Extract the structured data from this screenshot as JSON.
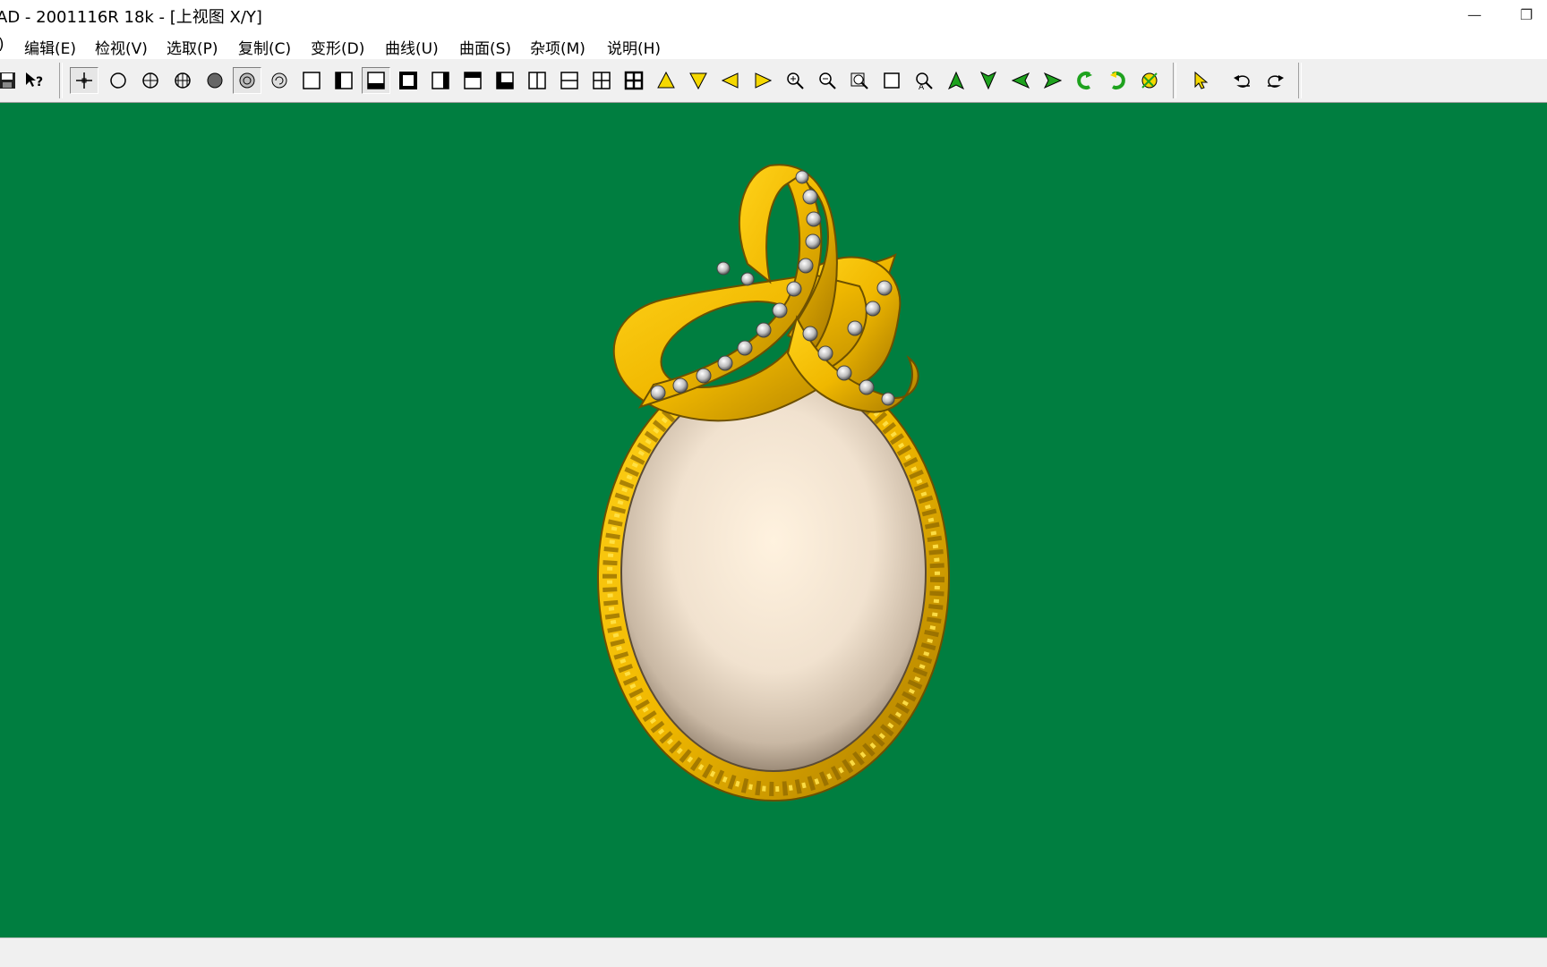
{
  "window": {
    "title": "AD - 2001116R 18k - [上视图 X/Y]",
    "minimize_glyph": "—",
    "restore_glyph": "❐"
  },
  "menu": {
    "partial_item": ")",
    "items": [
      "编辑(E)",
      "检视(V)",
      "选取(P)",
      "复制(C)",
      "变形(D)",
      "曲线(U)",
      "曲面(S)",
      "杂项(M)",
      "说明(H)"
    ]
  },
  "toolbar": {
    "help_glyph": "?",
    "icons": [
      "save-icon",
      "context-help-icon",
      "point-snap-icon",
      "circle-snap-icon",
      "center-snap-icon",
      "grid-snap-icon",
      "solid-dot-icon",
      "shaded-dot-icon",
      "refresh-circle-icon",
      "single-view-icon",
      "left-view-icon",
      "bottom-view-icon",
      "frame-view-icon",
      "right-view-icon",
      "top-view-icon",
      "bottom-panel-icon",
      "split-vertical-icon",
      "split-horizontal-icon",
      "four-view-icon",
      "four-view-bold-icon",
      "move-up-icon",
      "move-down-icon",
      "move-left-icon",
      "move-right-icon",
      "zoom-in-icon",
      "zoom-out-icon",
      "zoom-window-icon",
      "zoom-frame-icon",
      "zoom-all-icon",
      "rotate-up-icon",
      "rotate-down-icon",
      "rotate-left-icon",
      "rotate-right-icon",
      "rotate-ccw-icon",
      "rotate-cw-icon",
      "render-icon",
      "select-arrow-icon",
      "undo-icon",
      "redo-icon"
    ]
  },
  "viewport": {
    "background": "#007e40",
    "metal_color": "#f1c40f",
    "stone_color": "#f5e6d0",
    "diamond_color": "#c8c8c8"
  }
}
